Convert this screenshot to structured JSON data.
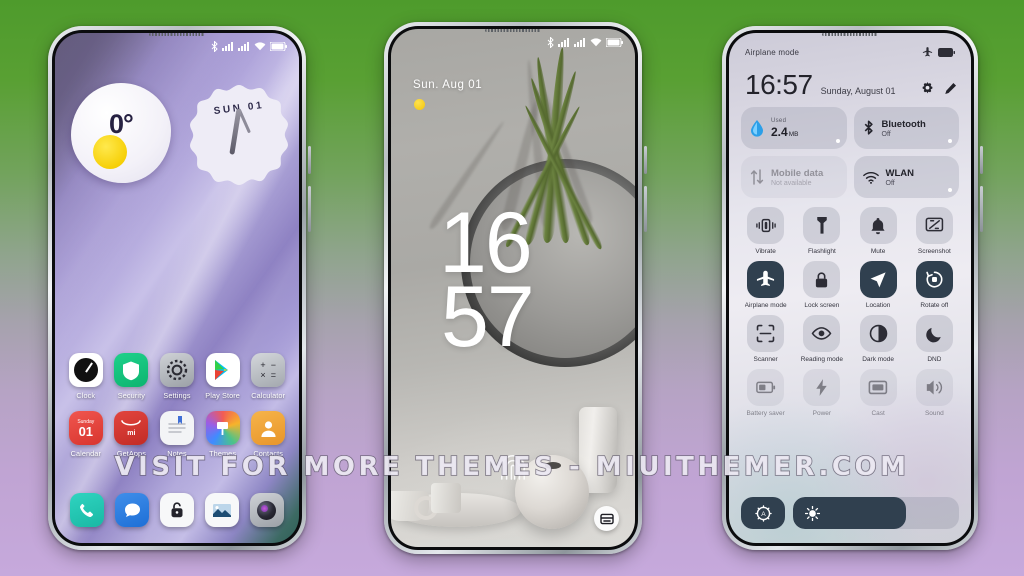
{
  "background": {
    "top_color": "#4e9b2c",
    "bottom_color": "#c6a9dc"
  },
  "watermark": {
    "text": "VISIT FOR MORE THEMES - MIUITHEMER.COM"
  },
  "phone1": {
    "name": "Home screen",
    "statusbar": {
      "icons": [
        "bluetooth-icon",
        "signal-icon",
        "signal-icon",
        "wifi-icon",
        "battery-icon"
      ]
    },
    "widgets": {
      "weather": {
        "temperature": "0°",
        "icon": "sun-icon"
      },
      "clock": {
        "label": "SUN 01"
      }
    },
    "apps": [
      {
        "label": "Clock",
        "icon": "clock-icon"
      },
      {
        "label": "Security",
        "icon": "shield-icon"
      },
      {
        "label": "Settings",
        "icon": "gear-icon"
      },
      {
        "label": "Play Store",
        "icon": "play-store-icon"
      },
      {
        "label": "Calculator",
        "icon": "calculator-icon"
      },
      {
        "label": "Calendar",
        "icon": "calendar-icon",
        "day_name": "Sunday",
        "day_number": "01"
      },
      {
        "label": "GetApps",
        "icon": "mi-icon"
      },
      {
        "label": "Notes",
        "icon": "notes-icon"
      },
      {
        "label": "Themes",
        "icon": "themes-icon"
      },
      {
        "label": "Contacts",
        "icon": "contacts-icon"
      }
    ],
    "dock": [
      {
        "label": "Phone",
        "icon": "phone-icon"
      },
      {
        "label": "Messages",
        "icon": "message-icon"
      },
      {
        "label": "Security",
        "icon": "lock-icon"
      },
      {
        "label": "Gallery",
        "icon": "gallery-icon"
      },
      {
        "label": "Camera",
        "icon": "camera-icon"
      }
    ]
  },
  "phone2": {
    "name": "Lock screen",
    "statusbar": {
      "icons": [
        "bluetooth-icon",
        "signal-icon",
        "signal-icon",
        "wifi-icon",
        "battery-icon"
      ]
    },
    "date": "Sun. Aug  01",
    "weather_icon": "sun-dot-icon",
    "time": {
      "hours": "16",
      "minutes": "57"
    },
    "fingerprint_icon": "fingerprint-icon",
    "shortcut_icon": "camera-shortcut-icon"
  },
  "phone3": {
    "name": "Control center",
    "status_text": "Airplane mode",
    "status_icons": [
      "airplane-icon",
      "battery-icon"
    ],
    "time": "16:57",
    "date": "Sunday, August 01",
    "header_icons": [
      "gear-icon",
      "pencil-icon"
    ],
    "big_tiles": [
      {
        "id": "data-usage",
        "icon": "droplet-icon",
        "top_label": "Used",
        "value": "2.4",
        "unit": "MB",
        "dimmed": false
      },
      {
        "id": "bluetooth",
        "icon": "bluetooth-icon",
        "title": "Bluetooth",
        "sub": "Off",
        "dimmed": false
      },
      {
        "id": "mobile-data",
        "icon": "data-arrows-icon",
        "title": "Mobile data",
        "sub": "Not available",
        "dimmed": true
      },
      {
        "id": "wlan",
        "icon": "wifi-icon",
        "title": "WLAN",
        "sub": "Off",
        "dimmed": false
      }
    ],
    "tiles": [
      {
        "label": "Vibrate",
        "icon": "vibrate-icon",
        "on": false
      },
      {
        "label": "Flashlight",
        "icon": "flashlight-icon",
        "on": false
      },
      {
        "label": "Mute",
        "icon": "bell-icon",
        "on": false
      },
      {
        "label": "Screenshot",
        "icon": "screenshot-icon",
        "on": false
      },
      {
        "label": "Airplane mode",
        "icon": "airplane-icon",
        "on": true
      },
      {
        "label": "Lock screen",
        "icon": "lock-icon",
        "on": false
      },
      {
        "label": "Location",
        "icon": "location-icon",
        "on": true
      },
      {
        "label": "Rotate off",
        "icon": "rotate-icon",
        "on": true
      },
      {
        "label": "Scanner",
        "icon": "scanner-icon",
        "on": false
      },
      {
        "label": "Reading mode",
        "icon": "eye-icon",
        "on": false
      },
      {
        "label": "Dark mode",
        "icon": "contrast-icon",
        "on": false
      },
      {
        "label": "DND",
        "icon": "moon-icon",
        "on": false
      },
      {
        "label": "Battery saver",
        "icon": "battery-icon",
        "on": false
      },
      {
        "label": "Power",
        "icon": "bolt-icon",
        "on": false
      },
      {
        "label": "Cast",
        "icon": "cast-icon",
        "on": false
      },
      {
        "label": "Sound",
        "icon": "sound-icon",
        "on": false
      }
    ],
    "brightness": {
      "auto_icon": "auto-brightness-icon",
      "slider_icon": "brightness-icon",
      "level": 68
    }
  }
}
